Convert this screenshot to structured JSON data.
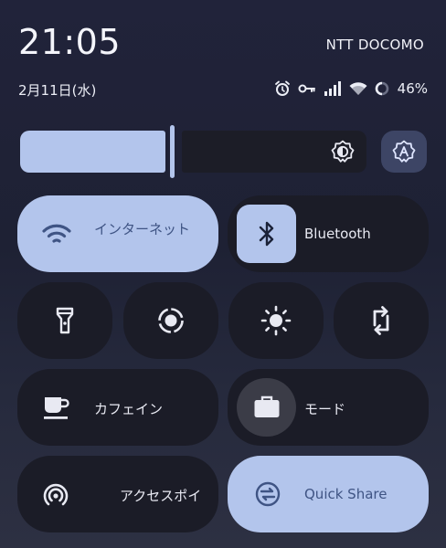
{
  "status_bar": {
    "time": "21:05",
    "carrier": "NTT DOCOMO",
    "date": "2月11日(水)",
    "battery_percent": "46%",
    "icons": [
      "alarm-icon",
      "key-icon",
      "signal-icon",
      "wifi-icon",
      "battery-icon"
    ]
  },
  "brightness": {
    "level": 0.42,
    "auto_brightness_icon": "auto-brightness-icon"
  },
  "tiles": {
    "internet": {
      "label": "インターネット",
      "icon": "wifi-icon",
      "active": true
    },
    "bluetooth": {
      "label": "Bluetooth",
      "icon": "bluetooth-icon",
      "active": true
    },
    "flashlight": {
      "icon": "flashlight-icon",
      "active": false
    },
    "screen_record": {
      "icon": "screen-record-icon",
      "active": false
    },
    "dark_mode": {
      "icon": "brightness-sun-icon",
      "active": false
    },
    "rotate": {
      "icon": "auto-rotate-icon",
      "active": false
    },
    "caffeine": {
      "label": "カフェイン",
      "icon": "coffee-cup-icon",
      "active": false
    },
    "mode": {
      "label": "モード",
      "icon": "briefcase-icon",
      "active": false
    },
    "hotspot": {
      "label": "アクセスポイ",
      "icon": "hotspot-icon",
      "active": false
    },
    "quick_share": {
      "label": "Quick Share",
      "icon": "quick-share-icon",
      "active": true
    }
  },
  "colors": {
    "active_tile": "#b3c5ec",
    "inactive_tile": "#1b1c27",
    "background": "#21233a"
  }
}
